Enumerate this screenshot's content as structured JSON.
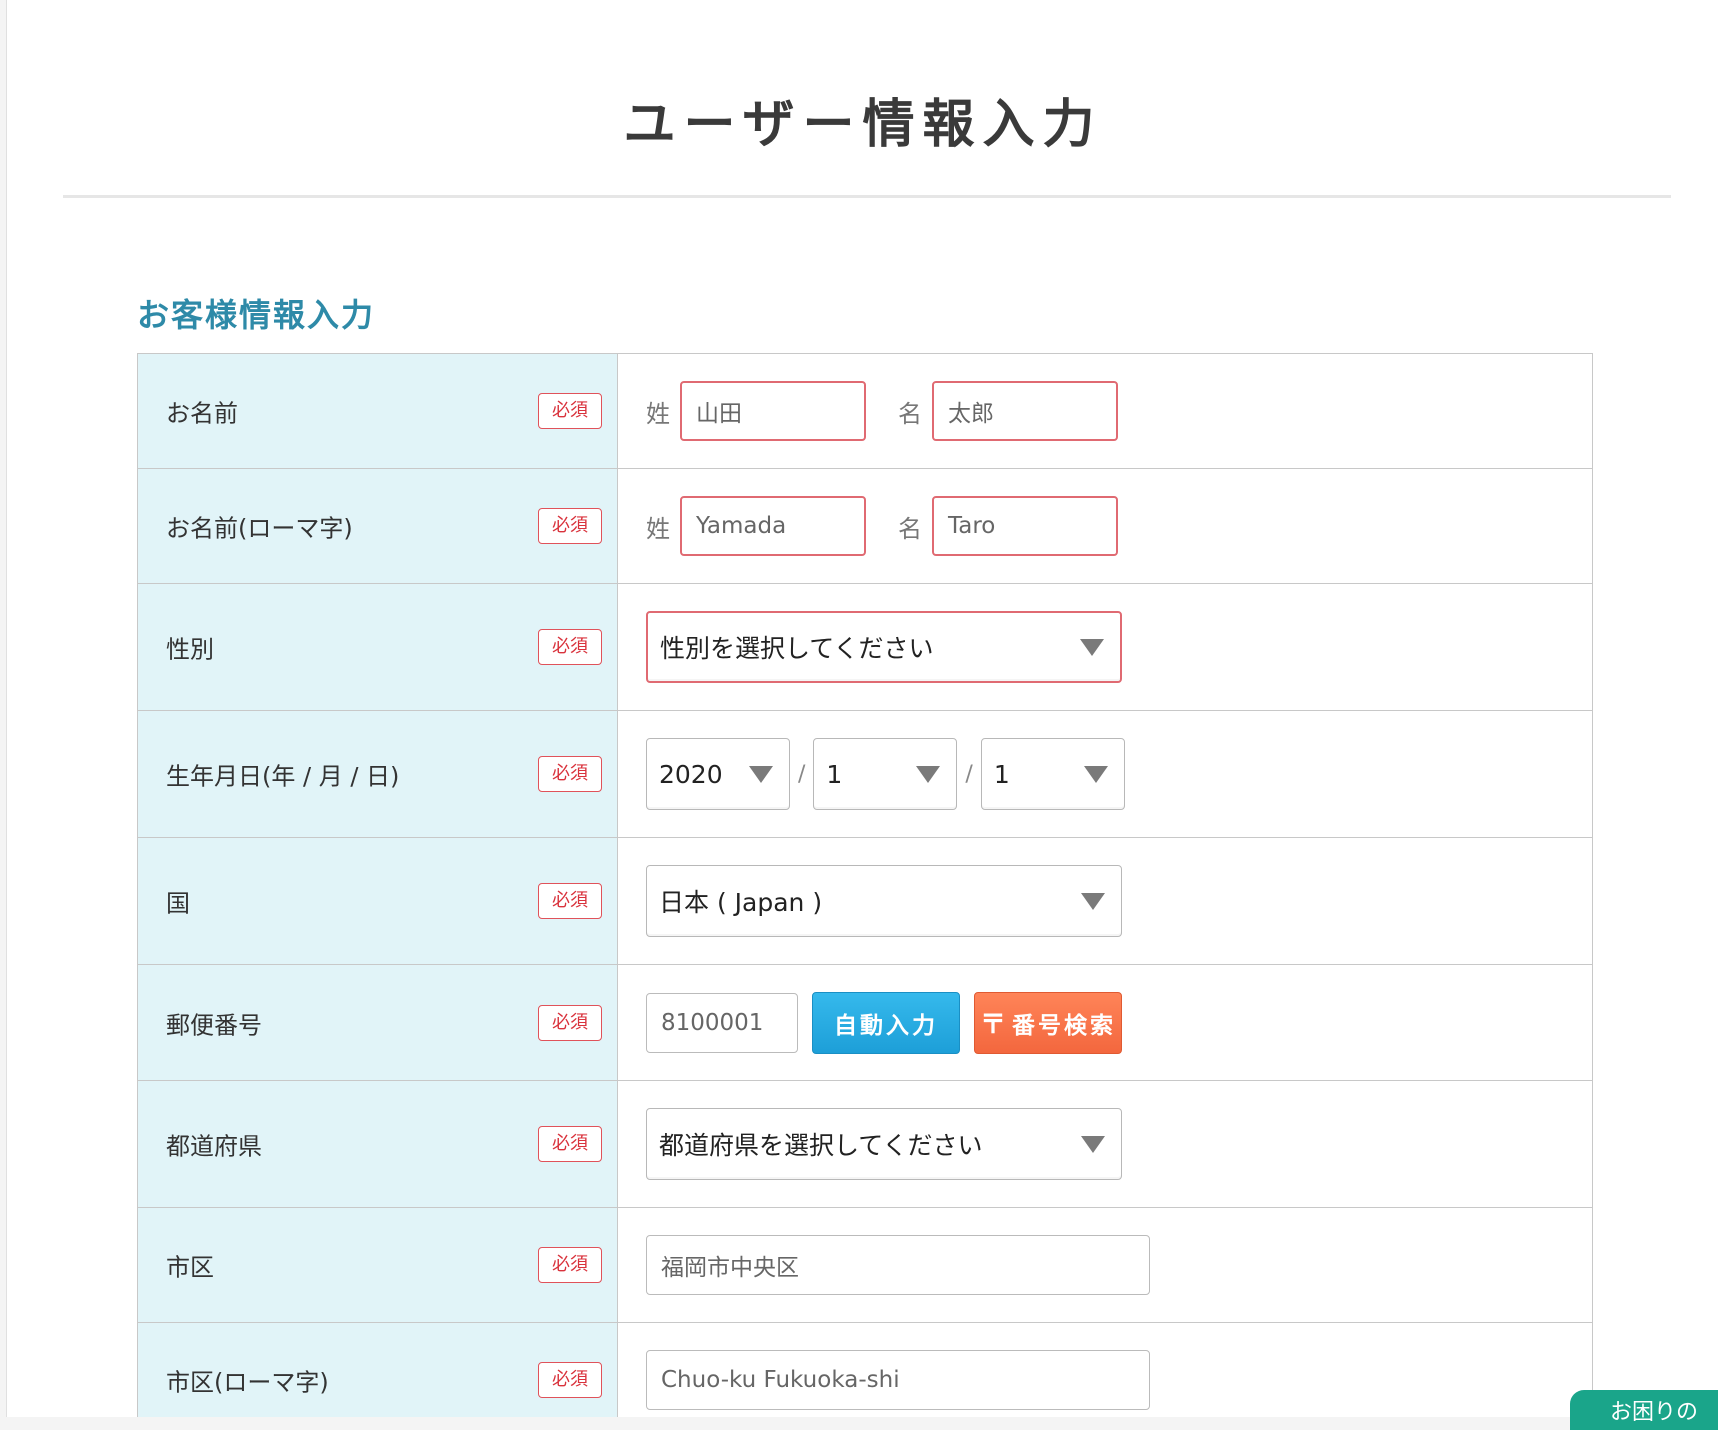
{
  "page": {
    "title": "ユーザー情報入力",
    "section_heading": "お客様情報入力"
  },
  "required_label": "必須",
  "form": {
    "name": {
      "label": "お名前",
      "last_label": "姓",
      "first_label": "名",
      "last_placeholder": "山田",
      "first_placeholder": "太郎"
    },
    "name_roman": {
      "label": "お名前(ローマ字)",
      "last_label": "姓",
      "first_label": "名",
      "last_placeholder": "Yamada",
      "first_placeholder": "Taro"
    },
    "gender": {
      "label": "性別",
      "selected": "性別を選択してください"
    },
    "birthdate": {
      "label": "生年月日(年 / 月 / 日)",
      "year": "2020",
      "month": "1",
      "day": "1",
      "separator": "/"
    },
    "country": {
      "label": "国",
      "selected": "日本 ( Japan )"
    },
    "postal": {
      "label": "郵便番号",
      "placeholder": "8100001",
      "auto_fill_button": "自動入力",
      "search_button": "番号検索",
      "postal_mark": "〒"
    },
    "prefecture": {
      "label": "都道府県",
      "selected": "都道府県を選択してください"
    },
    "city": {
      "label": "市区",
      "placeholder": "福岡市中央区"
    },
    "city_roman": {
      "label": "市区(ローマ字)",
      "placeholder": "Chuo-ku Fukuoka-shi"
    }
  },
  "help_tab": {
    "label": "お困りの"
  },
  "colors": {
    "label_bg": "#e1f4f8",
    "section_heading": "#2e8aa8",
    "required_red": "#d9323c",
    "auto_fill_blue": "#1d9fd8",
    "search_orange": "#f3673e",
    "help_green": "#1aa58a"
  }
}
